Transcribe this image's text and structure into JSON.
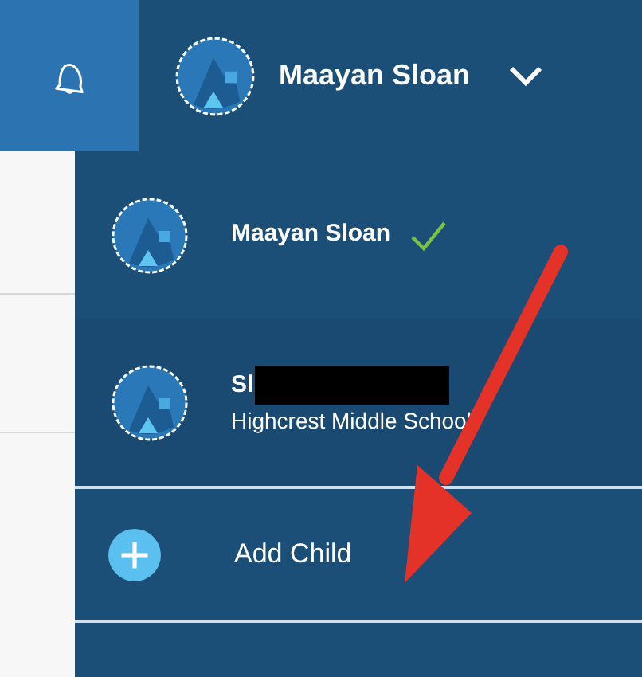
{
  "header": {
    "user_name": "Maayan Sloan"
  },
  "menu": {
    "accounts": [
      {
        "name": "Maayan Sloan",
        "selected": true
      },
      {
        "name": "Sl",
        "school": "Highcrest Middle School",
        "selected": false,
        "redacted": true
      }
    ],
    "add_label": "Add Child"
  }
}
